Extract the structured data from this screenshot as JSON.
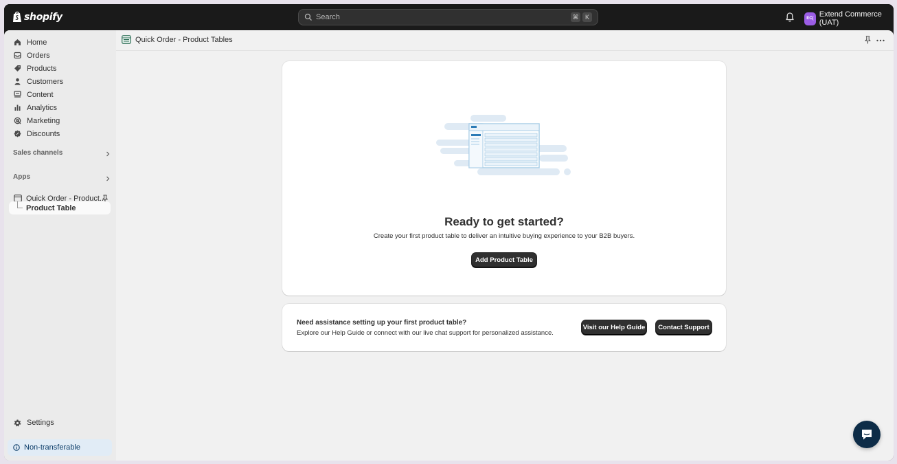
{
  "topbar": {
    "logo_text": "shopify",
    "search_placeholder": "Search",
    "shortcut_keys": [
      "⌘",
      "K"
    ],
    "store_initials": "EC(",
    "store_name": "Extend Commerce (UAT)"
  },
  "sidebar": {
    "items": [
      {
        "label": "Home",
        "icon": "home-icon"
      },
      {
        "label": "Orders",
        "icon": "orders-icon"
      },
      {
        "label": "Products",
        "icon": "tag-icon"
      },
      {
        "label": "Customers",
        "icon": "person-icon"
      },
      {
        "label": "Content",
        "icon": "content-icon"
      },
      {
        "label": "Analytics",
        "icon": "chart-icon"
      },
      {
        "label": "Marketing",
        "icon": "target-icon"
      },
      {
        "label": "Discounts",
        "icon": "discount-icon"
      }
    ],
    "sales_channels_label": "Sales channels",
    "apps_label": "Apps",
    "app_name": "Quick Order - Product...",
    "app_sub_item": "Product Table",
    "settings_label": "Settings",
    "non_transferable_label": "Non-transferable"
  },
  "page": {
    "title": "Quick Order - Product Tables"
  },
  "empty_state": {
    "heading": "Ready to get started?",
    "description": "Create your first product table to deliver an intuitive buying experience to your B2B buyers.",
    "button_label": "Add Product Table"
  },
  "help": {
    "heading": "Need assistance setting up your first product table?",
    "description": "Explore our Help Guide or connect with our live chat support for personalized assistance.",
    "guide_button": "Visit our Help Guide",
    "support_button": "Contact Support"
  },
  "colors": {
    "topbar": "#1a1a1a",
    "sidebar": "#ebebeb",
    "main_bg": "#f1f1f1",
    "primary_button": "#303030",
    "store_avatar": "#9b5de5",
    "chat_bubble": "#0d2c47"
  }
}
